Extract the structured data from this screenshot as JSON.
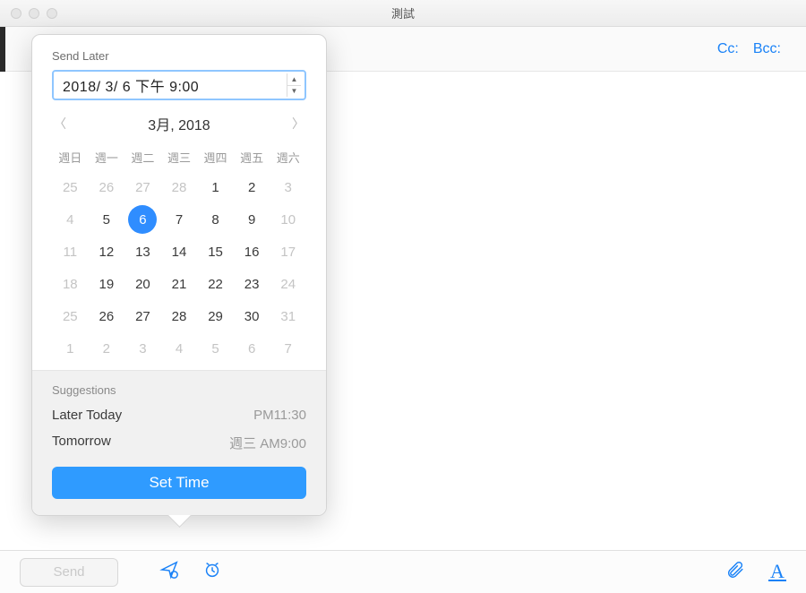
{
  "window": {
    "title": "測試"
  },
  "header": {
    "cc_label": "Cc:",
    "bcc_label": "Bcc:"
  },
  "bottom": {
    "send_label": "Send"
  },
  "popover": {
    "title": "Send Later",
    "datetime_value": "2018/ 3/ 6 下午  9:00",
    "month_label": "3月, 2018",
    "dow": [
      "週日",
      "週一",
      "週二",
      "週三",
      "週四",
      "週五",
      "週六"
    ],
    "grid": [
      [
        {
          "n": "25",
          "f": true
        },
        {
          "n": "26",
          "f": true
        },
        {
          "n": "27",
          "f": true
        },
        {
          "n": "28",
          "f": true
        },
        {
          "n": "1"
        },
        {
          "n": "2"
        },
        {
          "n": "3",
          "f": true
        }
      ],
      [
        {
          "n": "4",
          "f": true
        },
        {
          "n": "5"
        },
        {
          "n": "6",
          "sel": true
        },
        {
          "n": "7"
        },
        {
          "n": "8"
        },
        {
          "n": "9"
        },
        {
          "n": "10",
          "f": true
        }
      ],
      [
        {
          "n": "11",
          "f": true
        },
        {
          "n": "12"
        },
        {
          "n": "13"
        },
        {
          "n": "14"
        },
        {
          "n": "15"
        },
        {
          "n": "16"
        },
        {
          "n": "17",
          "f": true
        }
      ],
      [
        {
          "n": "18",
          "f": true
        },
        {
          "n": "19"
        },
        {
          "n": "20"
        },
        {
          "n": "21"
        },
        {
          "n": "22"
        },
        {
          "n": "23"
        },
        {
          "n": "24",
          "f": true
        }
      ],
      [
        {
          "n": "25",
          "f": true
        },
        {
          "n": "26"
        },
        {
          "n": "27"
        },
        {
          "n": "28"
        },
        {
          "n": "29"
        },
        {
          "n": "30"
        },
        {
          "n": "31",
          "f": true
        }
      ],
      [
        {
          "n": "1",
          "f": true
        },
        {
          "n": "2",
          "f": true
        },
        {
          "n": "3",
          "f": true
        },
        {
          "n": "4",
          "f": true
        },
        {
          "n": "5",
          "f": true
        },
        {
          "n": "6",
          "f": true
        },
        {
          "n": "7",
          "f": true
        }
      ]
    ],
    "suggestions_title": "Suggestions",
    "suggestions": [
      {
        "label": "Later Today",
        "time": "PM11:30"
      },
      {
        "label": "Tomorrow",
        "time": "週三 AM9:00"
      }
    ],
    "set_time_label": "Set Time"
  }
}
